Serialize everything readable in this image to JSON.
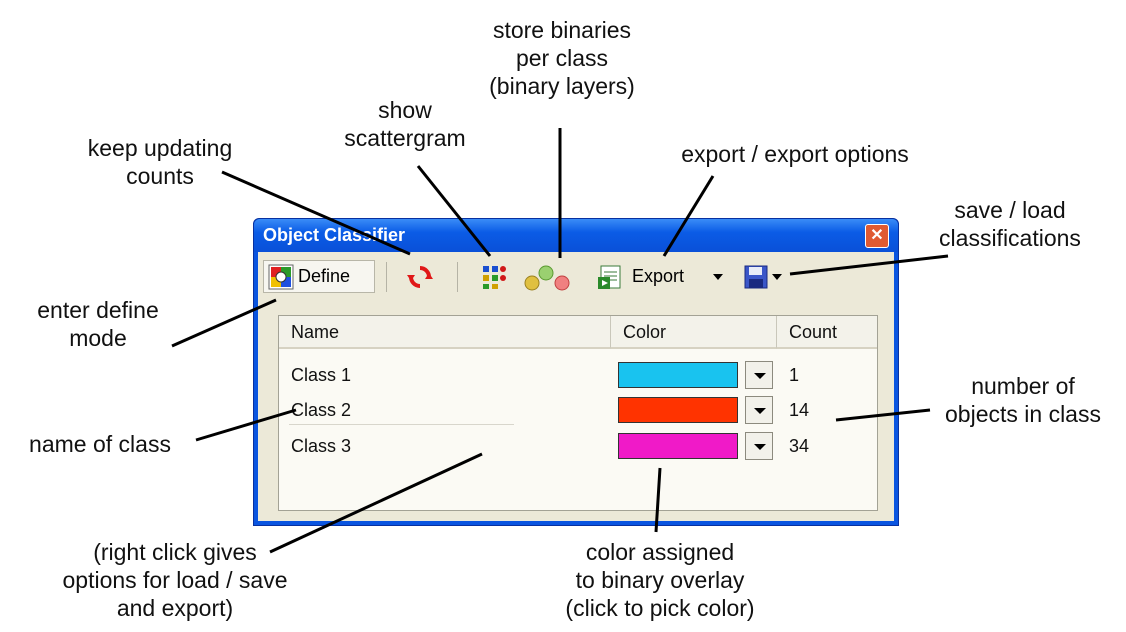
{
  "window": {
    "title": "Object Classifier",
    "close_glyph": "✕"
  },
  "toolbar": {
    "define_label": "Define",
    "define_icon": "define-mode-icon",
    "update_icon": "refresh-counts-icon",
    "scatter_icon": "scattergram-icon",
    "binaries_icon": "binary-layers-icon",
    "export_icon": "export-icon",
    "export_label": "Export",
    "save_icon": "floppy-disk-icon"
  },
  "table": {
    "columns": [
      "Name",
      "Color",
      "Count"
    ],
    "rows": [
      {
        "name": "Class 1",
        "color": "#19c3ef",
        "count": "1"
      },
      {
        "name": "Class 2",
        "color": "#ff3300",
        "count": "14"
      },
      {
        "name": "Class 3",
        "color": "#f01ac8",
        "count": "34"
      }
    ]
  },
  "annotations": {
    "store_binaries": [
      "store binaries",
      "per class",
      "(binary layers)"
    ],
    "show_scattergram": [
      "show",
      "scattergram"
    ],
    "keep_updating": [
      "keep updating",
      "counts"
    ],
    "export_options": [
      "export / export options"
    ],
    "save_load": [
      "save / load",
      "classifications"
    ],
    "define_mode": [
      "enter define",
      "mode"
    ],
    "name_of_class": [
      "name of class"
    ],
    "number_objects": [
      "number of",
      "objects in class"
    ],
    "right_click": [
      "(right click gives",
      "options for load / save",
      "and export)"
    ],
    "color_assigned": [
      "color assigned",
      "to binary overlay",
      "(click to pick color)"
    ]
  }
}
